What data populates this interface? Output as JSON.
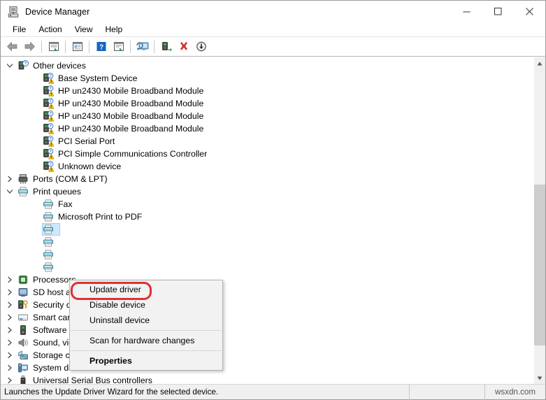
{
  "window": {
    "title": "Device Manager",
    "icon": "device-manager-icon",
    "controls": {
      "minimize": "—",
      "maximize": "□",
      "close": "✕"
    }
  },
  "menubar": {
    "items": [
      {
        "label": "File"
      },
      {
        "label": "Action"
      },
      {
        "label": "View"
      },
      {
        "label": "Help"
      }
    ]
  },
  "toolbar": {
    "items": [
      {
        "name": "back-icon"
      },
      {
        "name": "forward-icon"
      },
      {
        "name": "separator"
      },
      {
        "name": "show-hidden-devices-icon"
      },
      {
        "name": "separator"
      },
      {
        "name": "properties-icon"
      },
      {
        "name": "separator"
      },
      {
        "name": "help-icon"
      },
      {
        "name": "update-driver-icon"
      },
      {
        "name": "separator"
      },
      {
        "name": "scan-for-hardware-changes-icon"
      },
      {
        "name": "separator"
      },
      {
        "name": "enable-device-icon"
      },
      {
        "name": "uninstall-device-icon"
      },
      {
        "name": "download-driver-icon"
      }
    ]
  },
  "tree": {
    "rows": [
      {
        "label": "Other devices",
        "depth": 0,
        "chevron": "expanded",
        "icon": "unknown-device-icon",
        "selected": false
      },
      {
        "label": "Base System Device",
        "depth": 1,
        "chevron": "none",
        "icon": "warning-device-icon",
        "selected": false
      },
      {
        "label": "HP un2430 Mobile Broadband Module",
        "depth": 1,
        "chevron": "none",
        "icon": "warning-device-icon",
        "selected": false
      },
      {
        "label": "HP un2430 Mobile Broadband Module",
        "depth": 1,
        "chevron": "none",
        "icon": "warning-device-icon",
        "selected": false
      },
      {
        "label": "HP un2430 Mobile Broadband Module",
        "depth": 1,
        "chevron": "none",
        "icon": "warning-device-icon",
        "selected": false
      },
      {
        "label": "HP un2430 Mobile Broadband Module",
        "depth": 1,
        "chevron": "none",
        "icon": "warning-device-icon",
        "selected": false
      },
      {
        "label": "PCI Serial Port",
        "depth": 1,
        "chevron": "none",
        "icon": "warning-device-icon",
        "selected": false
      },
      {
        "label": "PCI Simple Communications Controller",
        "depth": 1,
        "chevron": "none",
        "icon": "warning-device-icon",
        "selected": false
      },
      {
        "label": "Unknown device",
        "depth": 1,
        "chevron": "none",
        "icon": "warning-device-icon",
        "selected": false
      },
      {
        "label": "Ports (COM & LPT)",
        "depth": 0,
        "chevron": "collapsed",
        "icon": "port-icon",
        "selected": false
      },
      {
        "label": "Print queues",
        "depth": 0,
        "chevron": "expanded",
        "icon": "printer-icon",
        "selected": false
      },
      {
        "label": "Fax",
        "depth": 1,
        "chevron": "none",
        "icon": "printer-icon",
        "selected": false
      },
      {
        "label": "Microsoft Print to PDF",
        "depth": 1,
        "chevron": "none",
        "icon": "printer-icon",
        "selected": false
      },
      {
        "label": "",
        "depth": 1,
        "chevron": "none",
        "icon": "printer-icon",
        "selected": true
      },
      {
        "label": "",
        "depth": 1,
        "chevron": "none",
        "icon": "printer-icon",
        "selected": false
      },
      {
        "label": "",
        "depth": 1,
        "chevron": "none",
        "icon": "printer-icon",
        "selected": false
      },
      {
        "label": "",
        "depth": 1,
        "chevron": "none",
        "icon": "printer-icon",
        "selected": false
      },
      {
        "label": "Processors",
        "depth": 0,
        "chevron": "collapsed",
        "icon": "processor-icon",
        "selected": false
      },
      {
        "label": "SD host adapters",
        "depth": 0,
        "chevron": "collapsed",
        "icon": "sd-host-adapter-icon",
        "selected": false
      },
      {
        "label": "Security devices",
        "depth": 0,
        "chevron": "collapsed",
        "icon": "security-device-icon",
        "selected": false
      },
      {
        "label": "Smart card readers",
        "depth": 0,
        "chevron": "collapsed",
        "icon": "smart-card-reader-icon",
        "selected": false
      },
      {
        "label": "Software devices",
        "depth": 0,
        "chevron": "collapsed",
        "icon": "software-device-icon",
        "selected": false
      },
      {
        "label": "Sound, video and game controllers",
        "depth": 0,
        "chevron": "collapsed",
        "icon": "sound-controller-icon",
        "selected": false
      },
      {
        "label": "Storage controllers",
        "depth": 0,
        "chevron": "collapsed",
        "icon": "storage-controller-icon",
        "selected": false
      },
      {
        "label": "System devices",
        "depth": 0,
        "chevron": "collapsed",
        "icon": "system-device-icon",
        "selected": false
      },
      {
        "label": "Universal Serial Bus controllers",
        "depth": 0,
        "chevron": "collapsed",
        "icon": "usb-controller-icon",
        "selected": false
      }
    ]
  },
  "context_menu": {
    "items": [
      {
        "label": "Update driver",
        "type": "item",
        "bold": false,
        "highlighted": true
      },
      {
        "label": "Disable device",
        "type": "item",
        "bold": false,
        "highlighted": false
      },
      {
        "label": "Uninstall device",
        "type": "item",
        "bold": false,
        "highlighted": false
      },
      {
        "label": "",
        "type": "separator"
      },
      {
        "label": "Scan for hardware changes",
        "type": "item",
        "bold": false,
        "highlighted": false
      },
      {
        "label": "",
        "type": "separator"
      },
      {
        "label": "Properties",
        "type": "item",
        "bold": true,
        "highlighted": false
      }
    ],
    "highlight_color": "#e03030"
  },
  "statusbar": {
    "message": "Launches the Update Driver Wizard for the selected device.",
    "middle": "",
    "watermark": "wsxdn.com"
  },
  "scrollbar": {
    "up_arrow": "▲",
    "down_arrow": "▼"
  }
}
